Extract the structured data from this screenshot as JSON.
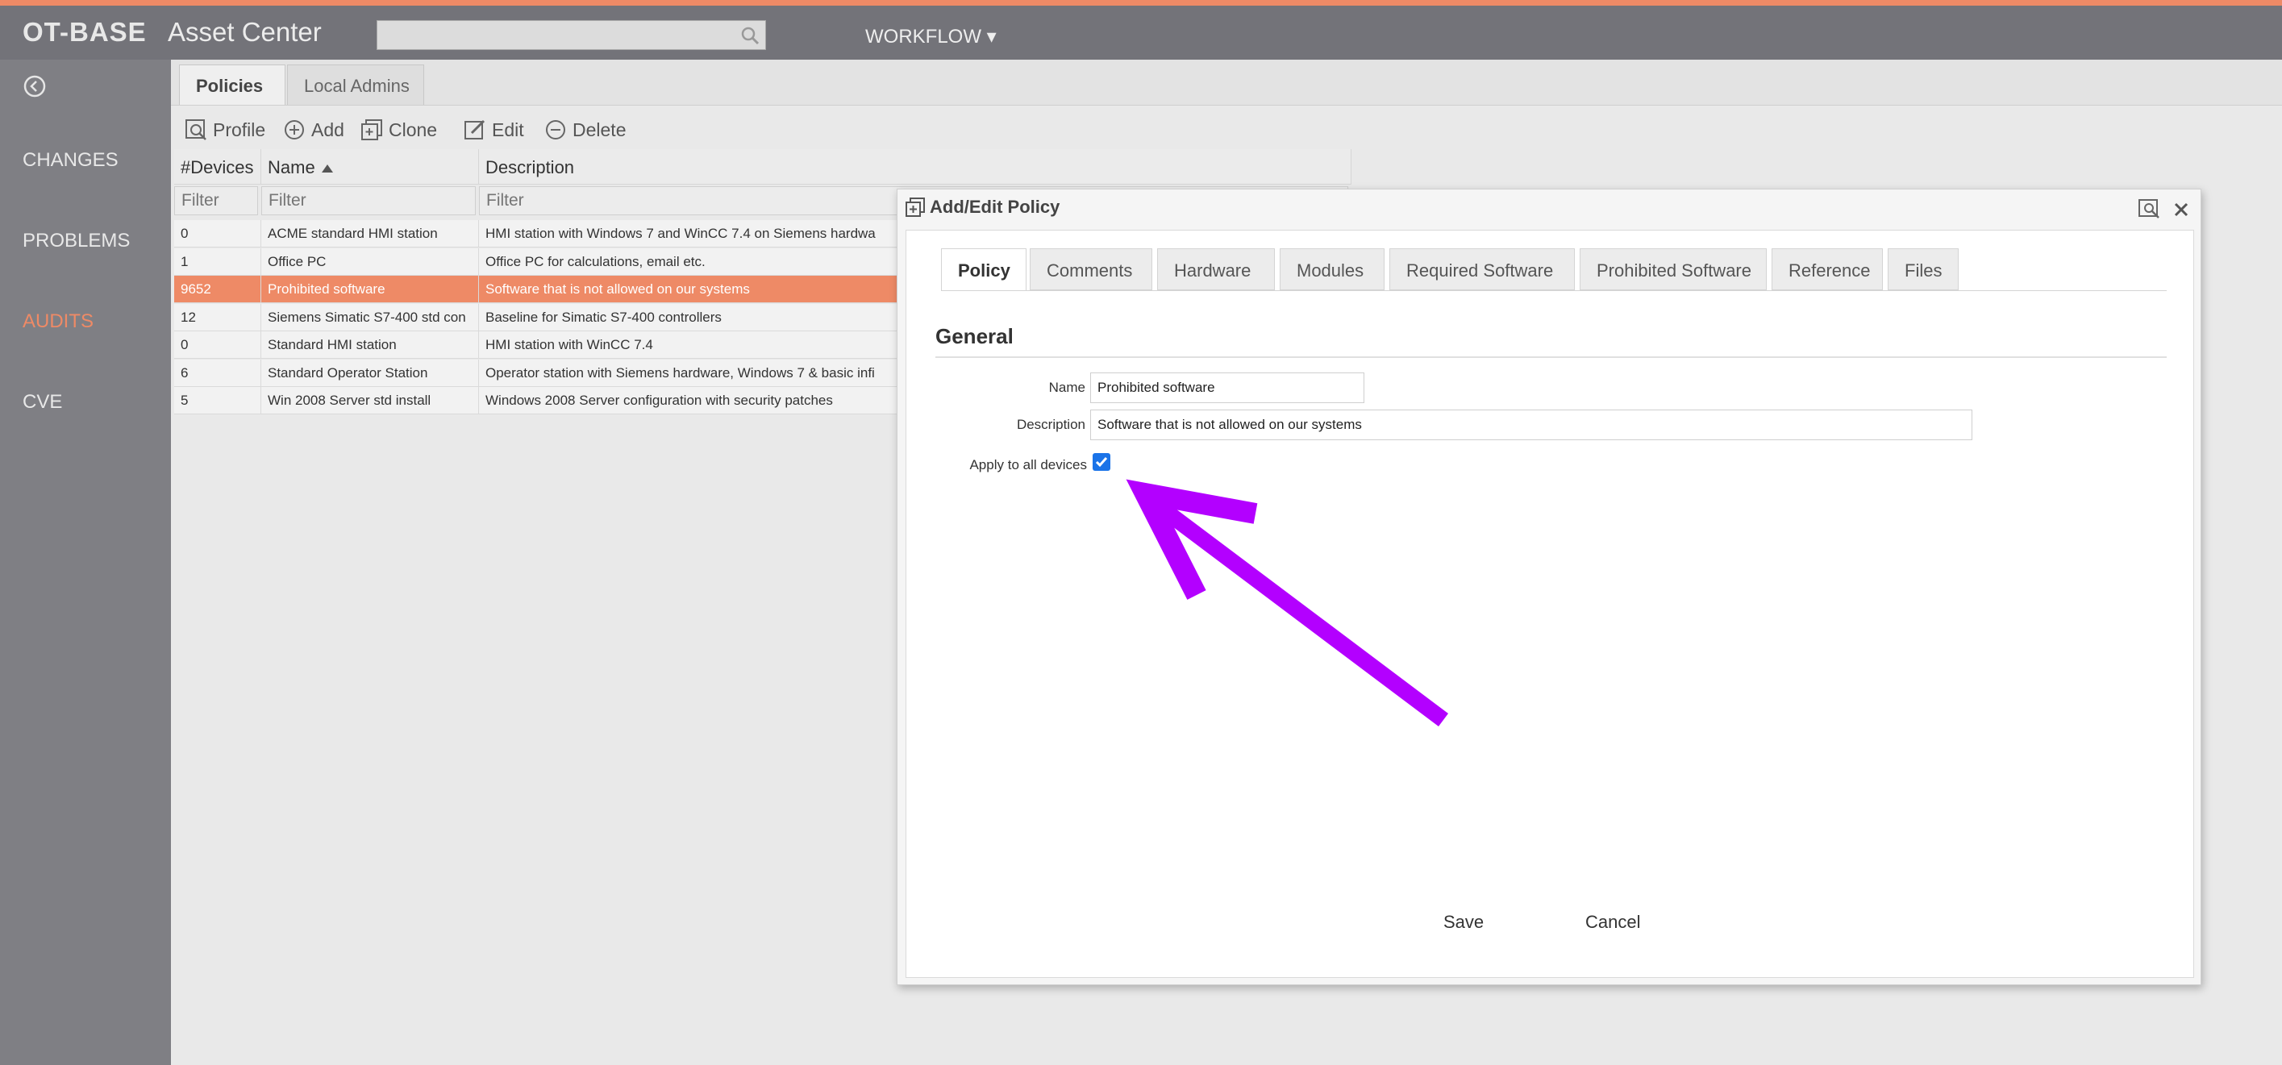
{
  "app": {
    "brand": "OT-BASE",
    "title": "Asset Center",
    "search_placeholder": "",
    "workflow_label": "WORKFLOW ▾"
  },
  "sidebar": {
    "items": [
      {
        "label": "CHANGES",
        "active": false
      },
      {
        "label": "PROBLEMS",
        "active": false
      },
      {
        "label": "AUDITS",
        "active": true
      },
      {
        "label": "CVE",
        "active": false
      }
    ]
  },
  "main": {
    "tabs": [
      {
        "label": "Policies",
        "active": true
      },
      {
        "label": "Local Admins",
        "active": false
      }
    ],
    "toolbar": {
      "profile": "Profile",
      "add": "Add",
      "clone": "Clone",
      "edit": "Edit",
      "delete": "Delete"
    },
    "table": {
      "columns": [
        "#Devices",
        "Name",
        "Description"
      ],
      "filter_placeholder": "Filter",
      "rows": [
        {
          "devices": "0",
          "name": "ACME standard HMI station",
          "description": "HMI station with Windows 7 and WinCC 7.4 on Siemens hardwa",
          "selected": false
        },
        {
          "devices": "1",
          "name": "Office PC",
          "description": "Office PC for calculations, email etc.",
          "selected": false
        },
        {
          "devices": "9652",
          "name": "Prohibited software",
          "description": "Software that is not allowed on our systems",
          "selected": true
        },
        {
          "devices": "12",
          "name": "Siemens Simatic S7-400 std con",
          "description": "Baseline for Simatic S7-400 controllers",
          "selected": false
        },
        {
          "devices": "0",
          "name": "Standard HMI station",
          "description": "HMI station with WinCC 7.4",
          "selected": false
        },
        {
          "devices": "6",
          "name": "Standard Operator Station",
          "description": "Operator station with Siemens hardware, Windows 7 & basic infi",
          "selected": false
        },
        {
          "devices": "5",
          "name": "Win 2008 Server std install",
          "description": "Windows 2008 Server configuration with security patches",
          "selected": false
        }
      ]
    }
  },
  "dialog": {
    "title": "Add/Edit Policy",
    "tabs": [
      {
        "label": "Policy",
        "active": true
      },
      {
        "label": "Comments",
        "active": false
      },
      {
        "label": "Hardware",
        "active": false
      },
      {
        "label": "Modules",
        "active": false
      },
      {
        "label": "Required Software",
        "active": false
      },
      {
        "label": "Prohibited Software",
        "active": false
      },
      {
        "label": "Reference",
        "active": false
      },
      {
        "label": "Files",
        "active": false
      }
    ],
    "section": "General",
    "fields": {
      "name_label": "Name",
      "name_value": "Prohibited software",
      "description_label": "Description",
      "description_value": "Software that is not allowed on our systems",
      "apply_label": "Apply to all devices",
      "apply_checked": true
    },
    "save": "Save",
    "cancel": "Cancel"
  },
  "colors": {
    "accent": "#ee8a66",
    "annotation_arrow": "#b300ff",
    "checkbox": "#1a73e8"
  }
}
